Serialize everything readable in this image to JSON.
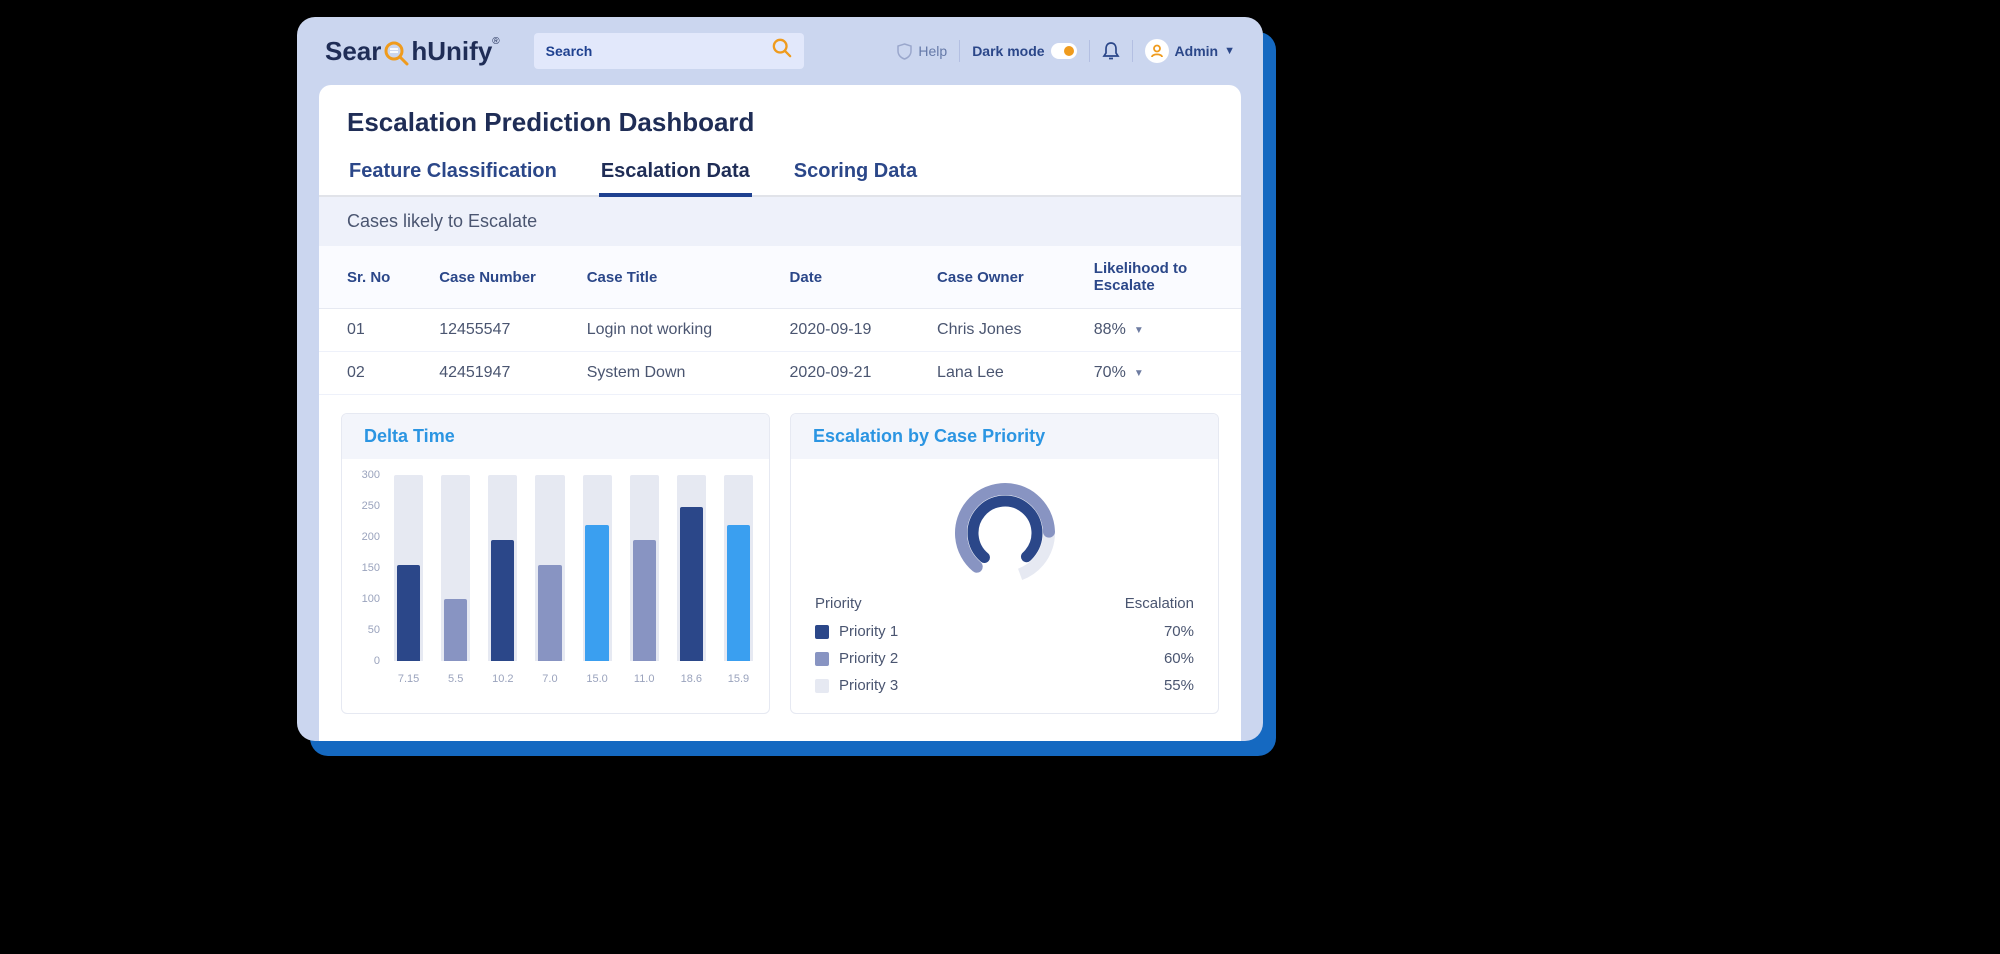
{
  "header": {
    "brand_left": "Sear",
    "brand_right": "hUnify",
    "search_placeholder": "Search",
    "help_label": "Help",
    "darkmode_label": "Dark mode",
    "admin_label": "Admin"
  },
  "page": {
    "title": "Escalation Prediction Dashboard"
  },
  "tabs": [
    {
      "label": "Feature Classification",
      "active": false
    },
    {
      "label": "Escalation Data",
      "active": true
    },
    {
      "label": "Scoring Data",
      "active": false
    }
  ],
  "cases": {
    "section_title": "Cases likely to Escalate",
    "columns": [
      "Sr. No",
      "Case Number",
      "Case Title",
      "Date",
      "Case Owner",
      "Likelihood to Escalate"
    ],
    "rows": [
      {
        "sr": "01",
        "case_no": "12455547",
        "title": "Login not working",
        "date": "2020-09-19",
        "owner": "Chris Jones",
        "likelihood": "88%"
      },
      {
        "sr": "02",
        "case_no": "42451947",
        "title": "System Down",
        "date": "2020-09-21",
        "owner": "Lana Lee",
        "likelihood": "70%"
      }
    ]
  },
  "delta_time": {
    "title": "Delta Time"
  },
  "priority": {
    "title": "Escalation by Case Priority",
    "col_priority": "Priority",
    "col_escalation": "Escalation",
    "items": [
      {
        "label": "Priority 1",
        "value": "70%",
        "color": "#2b4789"
      },
      {
        "label": "Priority 2",
        "value": "60%",
        "color": "#8894c2"
      },
      {
        "label": "Priority 3",
        "value": "55%",
        "color": "#e6e9f2"
      }
    ]
  },
  "chart_data": [
    {
      "type": "bar",
      "title": "Delta Time",
      "ylim": [
        0,
        300
      ],
      "y_ticks": [
        0,
        50,
        100,
        150,
        200,
        250,
        300
      ],
      "categories": [
        "7.15",
        "5.5",
        "10.2",
        "7.0",
        "15.0",
        "11.0",
        "18.6",
        "15.9"
      ],
      "series": [
        {
          "name": "value",
          "values": [
            155,
            100,
            195,
            155,
            220,
            195,
            248,
            220
          ],
          "colors": [
            "#2b4789",
            "#8894c2",
            "#2b4789",
            "#8894c2",
            "#3a9ff0",
            "#8894c2",
            "#2b4789",
            "#3a9ff0"
          ]
        },
        {
          "name": "total",
          "values": [
            300,
            300,
            300,
            300,
            300,
            300,
            300,
            300
          ]
        }
      ]
    },
    {
      "type": "pie",
      "title": "Escalation by Case Priority",
      "series": [
        {
          "name": "Priority 1",
          "value": 70,
          "color": "#2b4789"
        },
        {
          "name": "Priority 2",
          "value": 60,
          "color": "#8894c2"
        },
        {
          "name": "Priority 3",
          "value": 55,
          "color": "#e6e9f2"
        }
      ]
    }
  ]
}
